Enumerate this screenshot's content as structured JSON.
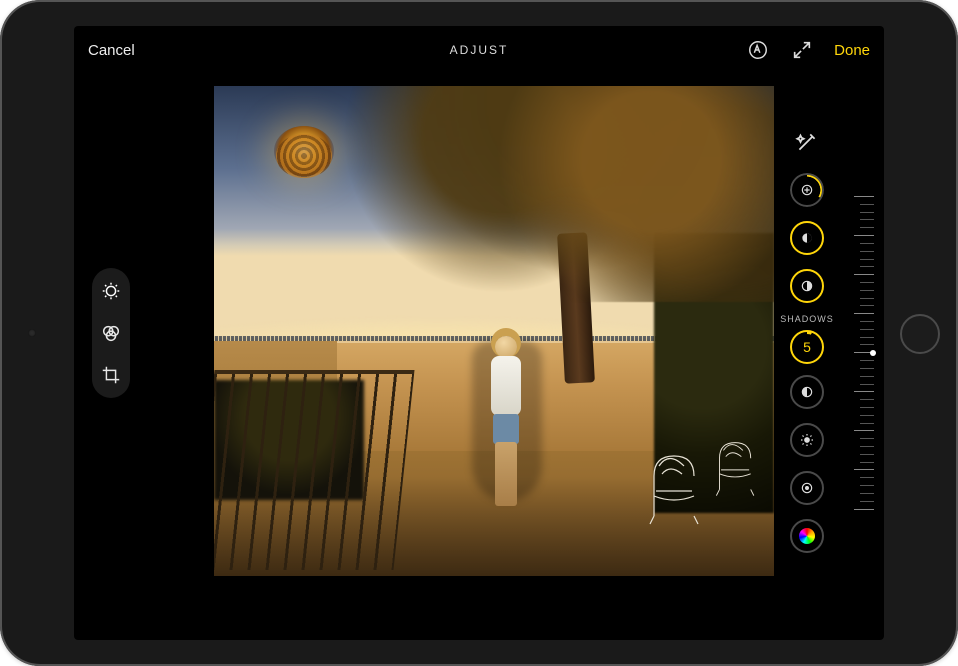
{
  "topbar": {
    "cancel_label": "Cancel",
    "title": "ADJUST",
    "done_label": "Done",
    "markup_icon": "markup-icon",
    "fullscreen_icon": "fullscreen-icon"
  },
  "left_modes": [
    {
      "name": "adjust-mode",
      "icon": "adjust-icon",
      "active": true
    },
    {
      "name": "filters-mode",
      "icon": "filters-icon",
      "active": false
    },
    {
      "name": "crop-mode",
      "icon": "crop-icon",
      "active": false
    }
  ],
  "adjust": {
    "current_tool_label": "SHADOWS",
    "current_value": "5",
    "tools": [
      {
        "name": "auto-enhance",
        "icon": "wand-icon",
        "style": "wand"
      },
      {
        "name": "exposure",
        "icon": "exposure-icon",
        "style": "partial"
      },
      {
        "name": "brilliance",
        "icon": "brilliance-icon",
        "style": "accent"
      },
      {
        "name": "highlights",
        "icon": "highlights-icon",
        "style": "accent"
      },
      {
        "name": "shadows",
        "icon": "shadows-icon",
        "style": "value"
      },
      {
        "name": "contrast",
        "icon": "contrast-icon",
        "style": "plain"
      },
      {
        "name": "brightness",
        "icon": "brightness-icon",
        "style": "plain"
      },
      {
        "name": "black-point",
        "icon": "blackpoint-icon",
        "style": "plain"
      },
      {
        "name": "saturation",
        "icon": "hue-icon",
        "style": "plain"
      }
    ]
  },
  "colors": {
    "accent": "#ffd60a",
    "background": "#000000"
  }
}
